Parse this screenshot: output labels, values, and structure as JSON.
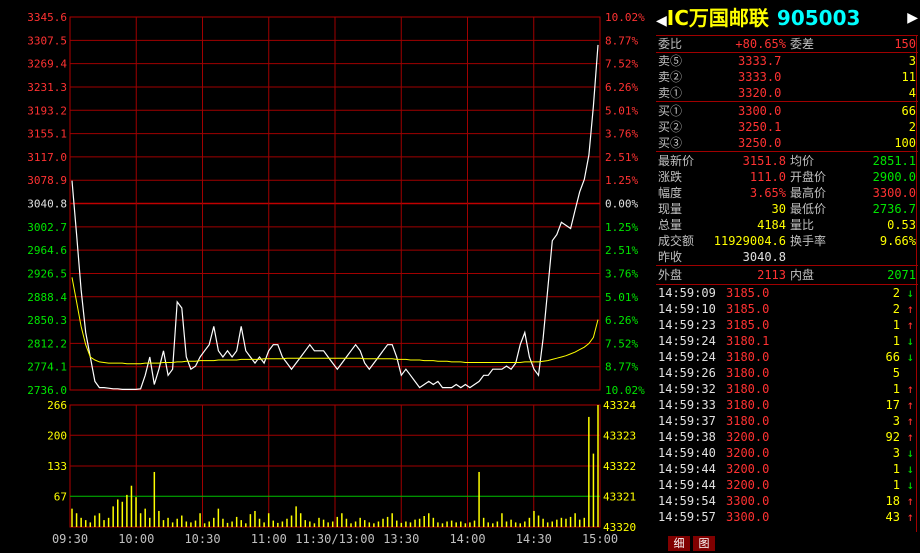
{
  "header": {
    "name": "IC万国邮联",
    "code": "905003",
    "left_arrow": "◀",
    "right_arrow": "▶"
  },
  "order_ratio": {
    "label1": "委比",
    "value1": "+80.65%",
    "label2": "委差",
    "value2": "150"
  },
  "asks": [
    {
      "label": "卖⑤",
      "price": "3333.7",
      "vol": "3"
    },
    {
      "label": "卖②",
      "price": "3333.0",
      "vol": "11"
    },
    {
      "label": "卖①",
      "price": "3320.0",
      "vol": "4"
    }
  ],
  "bids": [
    {
      "label": "买①",
      "price": "3300.0",
      "vol": "66"
    },
    {
      "label": "买②",
      "price": "3250.1",
      "vol": "2"
    },
    {
      "label": "买③",
      "price": "3250.0",
      "vol": "100"
    }
  ],
  "quote": [
    {
      "l1": "最新价",
      "v1": "3151.8",
      "l2": "均价",
      "v2": "2851.1",
      "c1": "red",
      "c2": "green"
    },
    {
      "l1": "涨跌",
      "v1": "111.0",
      "l2": "开盘价",
      "v2": "2900.0",
      "c1": "red",
      "c2": "green"
    },
    {
      "l1": "幅度",
      "v1": "3.65%",
      "l2": "最高价",
      "v2": "3300.0",
      "c1": "red",
      "c2": "red"
    },
    {
      "l1": "现量",
      "v1": "30",
      "l2": "最低价",
      "v2": "2736.7",
      "c1": "yellow",
      "c2": "green"
    },
    {
      "l1": "总量",
      "v1": "4184",
      "l2": "量比",
      "v2": "0.53",
      "c1": "yellow",
      "c2": "yellow"
    },
    {
      "l1": "成交额",
      "v1": "11929004.6",
      "l2": "换手率",
      "v2": "9.66%",
      "c1": "yellow",
      "c2": "yellow"
    },
    {
      "l1": "昨收",
      "v1": "3040.8",
      "l2": "",
      "v2": "",
      "c1": "white",
      "c2": "white"
    }
  ],
  "outer_inner": {
    "l1": "外盘",
    "v1": "2113",
    "l2": "内盘",
    "v2": "2071"
  },
  "ticks": [
    {
      "time": "14:59:09",
      "price": "3185.0",
      "vol": "2",
      "dir": "down"
    },
    {
      "time": "14:59:10",
      "price": "3185.0",
      "vol": "2",
      "dir": "up"
    },
    {
      "time": "14:59:23",
      "price": "3185.0",
      "vol": "1",
      "dir": "up"
    },
    {
      "time": "14:59:24",
      "price": "3180.1",
      "vol": "1",
      "dir": "down"
    },
    {
      "time": "14:59:24",
      "price": "3180.0",
      "vol": "66",
      "dir": "down"
    },
    {
      "time": "14:59:26",
      "price": "3180.0",
      "vol": "5",
      "dir": "none"
    },
    {
      "time": "14:59:32",
      "price": "3180.0",
      "vol": "1",
      "dir": "up"
    },
    {
      "time": "14:59:33",
      "price": "3180.0",
      "vol": "17",
      "dir": "up"
    },
    {
      "time": "14:59:37",
      "price": "3180.0",
      "vol": "3",
      "dir": "up"
    },
    {
      "time": "14:59:38",
      "price": "3200.0",
      "vol": "92",
      "dir": "up"
    },
    {
      "time": "14:59:40",
      "price": "3200.0",
      "vol": "3",
      "dir": "down"
    },
    {
      "time": "14:59:44",
      "price": "3200.0",
      "vol": "1",
      "dir": "down"
    },
    {
      "time": "14:59:44",
      "price": "3200.0",
      "vol": "1",
      "dir": "down"
    },
    {
      "time": "14:59:54",
      "price": "3300.0",
      "vol": "18",
      "dir": "up"
    },
    {
      "time": "14:59:57",
      "price": "3300.0",
      "vol": "43",
      "dir": "up"
    }
  ],
  "tabs": [
    "细",
    "图"
  ],
  "chart_data": {
    "type": "line",
    "price_axis_left": [
      "3345.6",
      "3307.5",
      "3269.4",
      "3231.3",
      "3193.2",
      "3155.1",
      "3117.0",
      "3078.9",
      "3040.8",
      "3002.7",
      "2964.6",
      "2926.5",
      "2888.4",
      "2850.3",
      "2812.2",
      "2774.1",
      "2736.0"
    ],
    "pct_axis_right": [
      "10.02%",
      "8.77%",
      "7.52%",
      "6.26%",
      "5.01%",
      "3.76%",
      "2.51%",
      "1.25%",
      "0.00%",
      "1.25%",
      "2.51%",
      "3.76%",
      "5.01%",
      "6.26%",
      "7.52%",
      "8.77%",
      "10.02%"
    ],
    "vol_axis_left": [
      "266",
      "200",
      "133",
      "67"
    ],
    "vol_axis_right": [
      "43324",
      "43323",
      "43322",
      "43321",
      "43320"
    ],
    "x_labels": [
      "09:30",
      "10:00",
      "10:30",
      "11:00",
      "11:30/13:00",
      "13:30",
      "14:00",
      "14:30",
      "15:00"
    ],
    "prev_close": 3040.8,
    "price_range": [
      2736.0,
      3345.6
    ],
    "vol_range": [
      0,
      266
    ],
    "price_series": [
      3078,
      2990,
      2900,
      2830,
      2790,
      2750,
      2740,
      2740,
      2739,
      2738,
      2738,
      2737,
      2737,
      2737,
      2737,
      2738,
      2760,
      2790,
      2745,
      2770,
      2800,
      2760,
      2770,
      2880,
      2870,
      2790,
      2770,
      2775,
      2790,
      2800,
      2810,
      2840,
      2800,
      2790,
      2800,
      2790,
      2800,
      2840,
      2800,
      2790,
      2780,
      2790,
      2780,
      2800,
      2810,
      2810,
      2790,
      2780,
      2770,
      2780,
      2790,
      2800,
      2810,
      2800,
      2800,
      2800,
      2790,
      2780,
      2770,
      2780,
      2790,
      2800,
      2810,
      2800,
      2780,
      2770,
      2780,
      2790,
      2800,
      2810,
      2810,
      2790,
      2760,
      2770,
      2760,
      2750,
      2740,
      2745,
      2750,
      2745,
      2750,
      2740,
      2740,
      2740,
      2745,
      2740,
      2745,
      2740,
      2745,
      2750,
      2760,
      2760,
      2770,
      2770,
      2770,
      2775,
      2770,
      2780,
      2810,
      2830,
      2790,
      2770,
      2760,
      2820,
      2900,
      2980,
      2990,
      3010,
      3005,
      3000,
      3030,
      3060,
      3080,
      3120,
      3200,
      3300
    ],
    "avg_series": [
      2920,
      2880,
      2840,
      2810,
      2790,
      2785,
      2782,
      2781,
      2780,
      2780,
      2780,
      2780,
      2779,
      2779,
      2779,
      2779,
      2780,
      2780,
      2780,
      2780,
      2781,
      2781,
      2781,
      2782,
      2782,
      2783,
      2783,
      2783,
      2784,
      2784,
      2784,
      2784,
      2785,
      2785,
      2785,
      2785,
      2785,
      2786,
      2786,
      2786,
      2786,
      2786,
      2787,
      2787,
      2787,
      2787,
      2787,
      2788,
      2788,
      2788,
      2788,
      2788,
      2788,
      2788,
      2788,
      2788,
      2788,
      2788,
      2788,
      2788,
      2788,
      2788,
      2788,
      2788,
      2787,
      2787,
      2787,
      2787,
      2787,
      2787,
      2787,
      2786,
      2786,
      2786,
      2785,
      2785,
      2785,
      2784,
      2784,
      2784,
      2783,
      2783,
      2783,
      2782,
      2782,
      2782,
      2781,
      2781,
      2781,
      2781,
      2781,
      2781,
      2781,
      2781,
      2781,
      2781,
      2781,
      2781,
      2781,
      2782,
      2782,
      2782,
      2782,
      2783,
      2784,
      2786,
      2788,
      2790,
      2792,
      2795,
      2798,
      2802,
      2806,
      2812,
      2822,
      2851
    ],
    "volume_series": [
      40,
      30,
      20,
      15,
      10,
      25,
      30,
      15,
      20,
      45,
      60,
      55,
      70,
      90,
      65,
      30,
      40,
      20,
      120,
      35,
      15,
      20,
      10,
      18,
      25,
      12,
      10,
      14,
      30,
      8,
      12,
      20,
      40,
      18,
      9,
      12,
      22,
      15,
      8,
      28,
      35,
      18,
      10,
      30,
      14,
      9,
      12,
      18,
      25,
      45,
      30,
      15,
      12,
      8,
      20,
      16,
      10,
      12,
      22,
      30,
      18,
      8,
      12,
      20,
      15,
      10,
      8,
      12,
      18,
      22,
      30,
      14,
      9,
      12,
      10,
      16,
      18,
      24,
      30,
      20,
      10,
      8,
      12,
      14,
      10,
      12,
      8,
      10,
      14,
      120,
      20,
      10,
      8,
      12,
      30,
      12,
      16,
      10,
      8,
      12,
      20,
      35,
      25,
      18,
      10,
      12,
      16,
      20,
      18,
      22,
      30,
      16,
      20,
      240,
      160,
      266
    ]
  }
}
